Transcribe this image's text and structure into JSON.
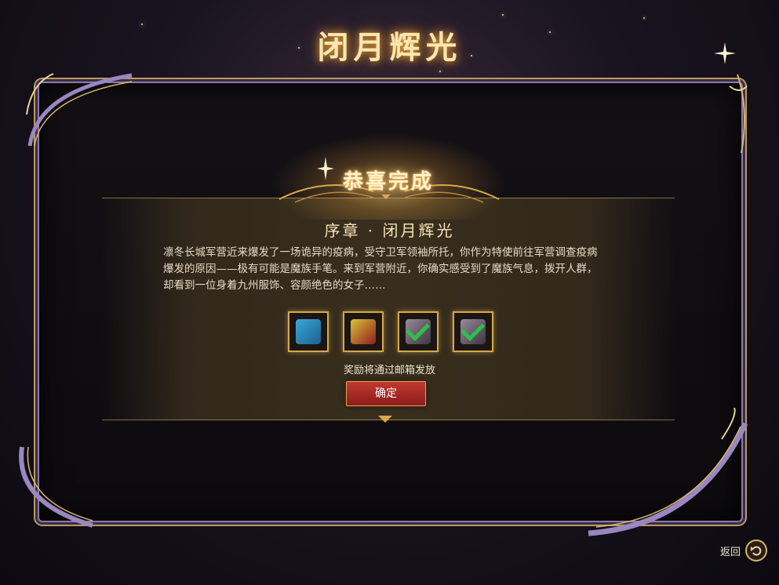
{
  "screen_title": "闭月辉光",
  "congrats_label": "恭喜完成",
  "chapter_title": "序章 · 闭月辉光",
  "description_lines": [
    "凛冬长城军营近来爆发了一场诡异的疫病，受守卫军领袖所托，你作为特使前往军营调查疫病",
    "爆发的原因——极有可能是魔族手笔。来到军营附近，你确实感受到了魔族气息，拨开人群，",
    "却看到一位身着九州服饰、容颜绝色的女子……"
  ],
  "rewards": [
    {
      "icon": "gift-box-icon",
      "claimed": false
    },
    {
      "icon": "gift-box-icon",
      "claimed": false
    },
    {
      "icon": "item-bundle-icon",
      "claimed": true
    },
    {
      "icon": "item-bundle-icon",
      "claimed": true
    }
  ],
  "mail_note": "奖励将通过邮箱发放",
  "confirm_label": "确定",
  "back_label": "返回",
  "colors": {
    "accent_gold": "#d7a84a",
    "button_red": "#a82a26",
    "check_green": "#2cbf4a"
  }
}
